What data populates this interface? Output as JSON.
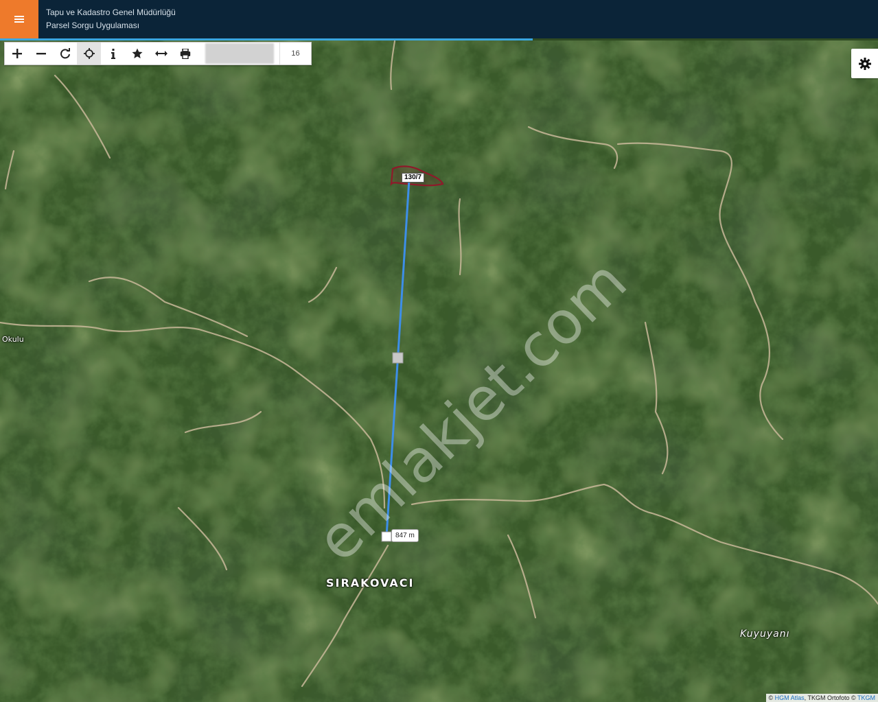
{
  "header": {
    "title_line1": "Tapu ve Kadastro Genel Müdürlüğü",
    "title_line2": "Parsel Sorgu Uygulaması"
  },
  "toolbar": {
    "tools": [
      "zoom-in",
      "zoom-out",
      "refresh",
      "locate",
      "info",
      "favorite",
      "measure",
      "print"
    ],
    "zoom_level": "16"
  },
  "map": {
    "places": {
      "sirakovaci": "SIRAKOVACI",
      "kuyuyani": "Kuyuyanı",
      "okulu": "Okulu"
    },
    "parcel_label": "130/7",
    "distance_label": "847 m",
    "watermark": "emlakjet.com"
  },
  "attribution": {
    "prefix": "©",
    "hgm": "HGM Atlas",
    "middle": ", TKGM Ortofoto ©",
    "tkgm": "TKGM"
  },
  "colors": {
    "header_bg": "#0b2438",
    "menu_accent": "#ee7a2b",
    "measure_line": "#3d8ee8",
    "parcel_outline": "#8e1a2a"
  }
}
